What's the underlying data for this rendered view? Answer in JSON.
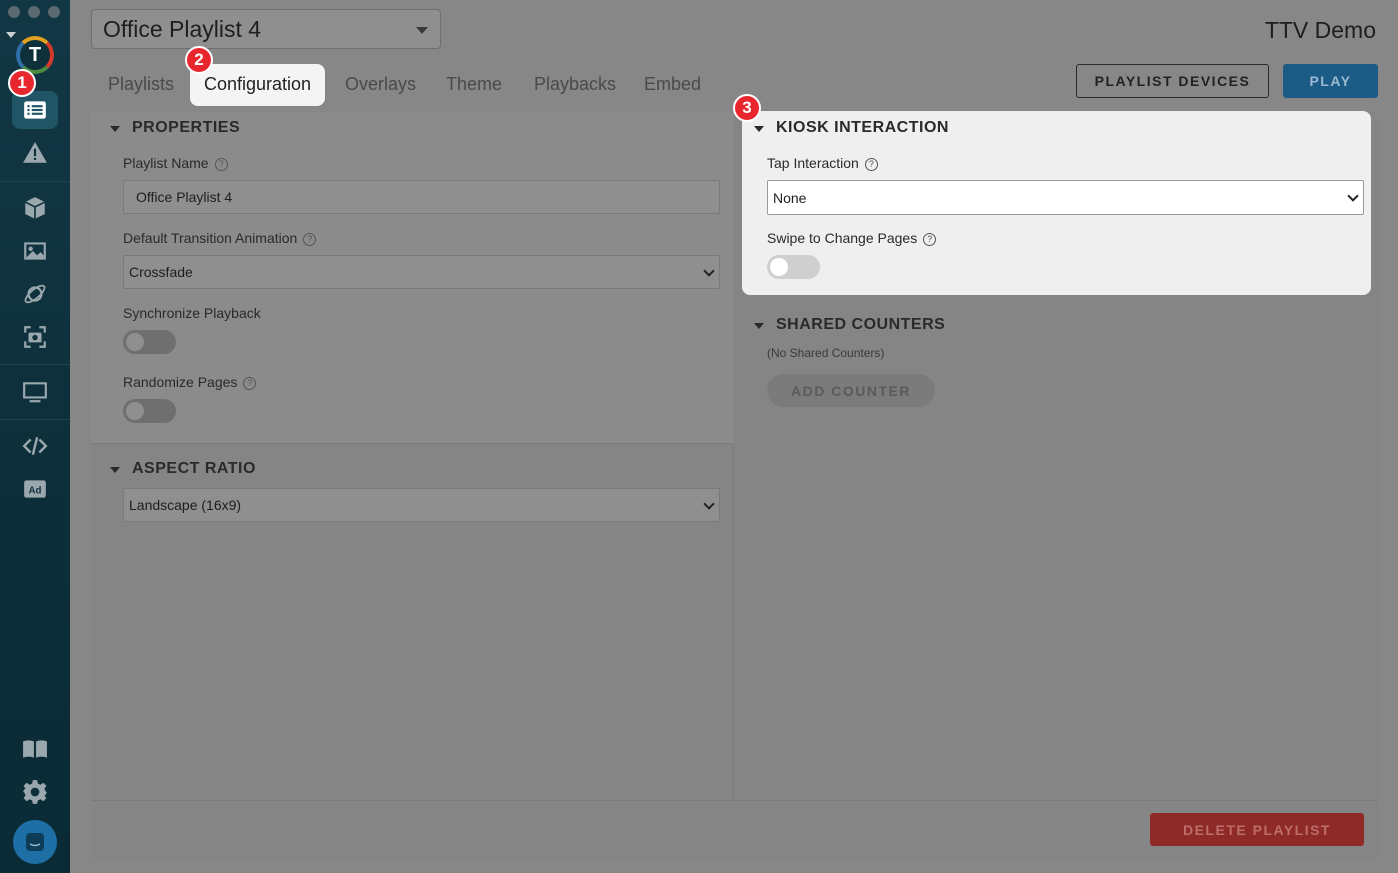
{
  "header": {
    "playlist_selected": "Office Playlist 4",
    "account_name": "TTV Demo"
  },
  "sidebar": {
    "logo_letter": "T",
    "items": [
      {
        "icon": "list-icon",
        "active": true
      },
      {
        "icon": "alert-icon"
      },
      {
        "icon": "cube-icon"
      },
      {
        "icon": "image-icon"
      },
      {
        "icon": "orbit-icon"
      },
      {
        "icon": "camera-scan-icon"
      },
      {
        "icon": "monitor-icon"
      },
      {
        "icon": "code-icon"
      },
      {
        "icon": "ad-icon"
      },
      {
        "icon": "book-icon"
      },
      {
        "icon": "gear-icon"
      },
      {
        "icon": "chat-icon"
      }
    ]
  },
  "annotations": {
    "one": "1",
    "two": "2",
    "three": "3"
  },
  "tabs": [
    {
      "label": "Playlists"
    },
    {
      "label": "Configuration",
      "active": true
    },
    {
      "label": "Overlays"
    },
    {
      "label": "Theme"
    },
    {
      "label": "Playbacks"
    },
    {
      "label": "Embed"
    }
  ],
  "actions": {
    "playlist_devices": "PLAYLIST DEVICES",
    "play": "PLAY",
    "delete_playlist": "DELETE PLAYLIST",
    "add_counter": "ADD COUNTER"
  },
  "properties": {
    "title": "PROPERTIES",
    "playlist_name_label": "Playlist Name",
    "playlist_name_value": "Office Playlist 4",
    "transition_label": "Default Transition Animation",
    "transition_value": "Crossfade",
    "sync_label": "Synchronize Playback",
    "randomize_label": "Randomize Pages"
  },
  "aspect_ratio": {
    "title": "ASPECT RATIO",
    "value": "Landscape (16x9)"
  },
  "kiosk": {
    "title": "KIOSK INTERACTION",
    "tap_label": "Tap Interaction",
    "tap_value": "None",
    "swipe_label": "Swipe to Change Pages"
  },
  "shared_counters": {
    "title": "SHARED COUNTERS",
    "empty_text": "(No Shared Counters)"
  },
  "help_glyph": "?"
}
